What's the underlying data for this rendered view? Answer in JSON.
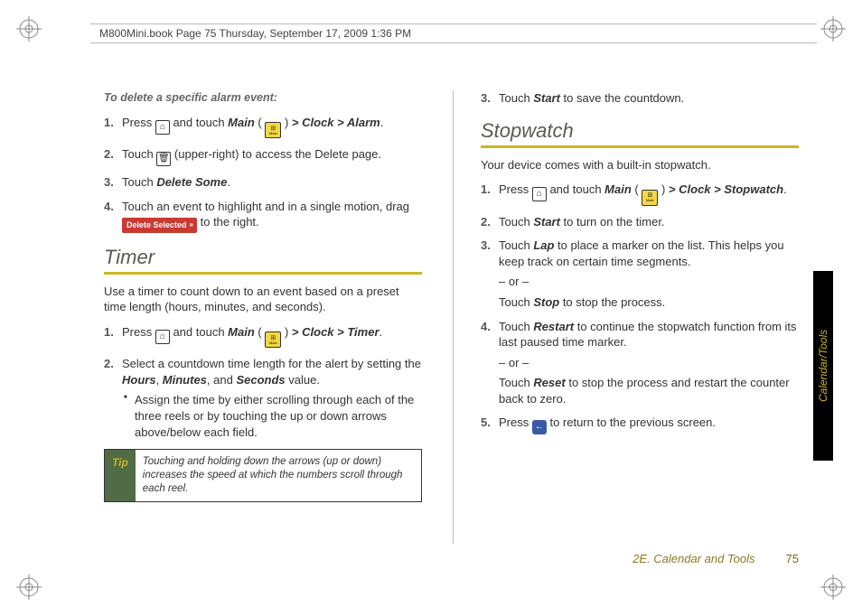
{
  "header": "M800Mini.book  Page 75  Thursday, September 17, 2009  1:36 PM",
  "left": {
    "delete_heading": "To delete a specific alarm event:",
    "steps_delete": [
      {
        "n": "1.",
        "pre": "Press ",
        "btn": "home",
        "mid": " and touch ",
        "label": "Main",
        "paren_open": " ( ",
        "main_icon": "main",
        "paren_close": " ) ",
        "path": "> Clock > Alarm",
        "post": "."
      },
      {
        "n": "2.",
        "pre": "Touch ",
        "btn": "delete-page",
        "post": " (upper-right) to access the Delete page."
      },
      {
        "n": "3.",
        "pre": "Touch ",
        "label": "Delete Some",
        "post": "."
      },
      {
        "n": "4.",
        "pre": "Touch an event to highlight and in a single motion, drag ",
        "redbtn": "Delete Selected",
        "post": " to the right."
      }
    ],
    "timer_heading": "Timer",
    "timer_intro": "Use a timer to count down to an event based on a preset time length (hours, minutes, and seconds).",
    "steps_timer": [
      {
        "n": "1.",
        "pre": "Press ",
        "btn": "home",
        "mid": " and touch ",
        "label": "Main",
        "paren_open": " ( ",
        "main_icon": "main",
        "paren_close": " ) ",
        "path": "> Clock > Timer",
        "post": "."
      },
      {
        "n": "2.",
        "pre": "Select a countdown time length for the alert by setting the ",
        "terms": [
          "Hours",
          "Minutes",
          "Seconds"
        ],
        "post": " value.",
        "bullet": "Assign the time by either scrolling through each of the three reels or by touching the up or down arrows above/below each field."
      }
    ],
    "tip_label": "Tip",
    "tip_text": "Touching and holding down the arrows (up or down) increases the speed at which the numbers scroll through each reel."
  },
  "right": {
    "continuation_step": {
      "n": "3.",
      "pre": "Touch ",
      "label": "Start",
      "post": " to save the countdown."
    },
    "stopwatch_heading": "Stopwatch",
    "stopwatch_intro": "Your device comes with a built-in stopwatch.",
    "steps_stopwatch": [
      {
        "n": "1.",
        "pre": "Press ",
        "btn": "home",
        "mid": " and touch ",
        "label": "Main",
        "paren_open": " ( ",
        "main_icon": "main",
        "paren_close": " ) ",
        "path": "> Clock > Stopwatch",
        "post": "."
      },
      {
        "n": "2.",
        "pre": "Touch ",
        "label": "Start",
        "post": " to turn on the timer."
      },
      {
        "n": "3.",
        "pre": "Touch ",
        "label": "Lap",
        "post": " to place a marker on the list. This helps you keep track on certain time segments.",
        "or": "– or –",
        "alt_pre": "Touch ",
        "alt_label": "Stop",
        "alt_post": " to stop the process."
      },
      {
        "n": "4.",
        "pre": "Touch ",
        "label": "Restart",
        "post": " to continue the stopwatch function from its last paused time marker.",
        "or": "– or –",
        "alt_pre": "Touch ",
        "alt_label": "Reset",
        "alt_post": " to stop the process and restart the counter back to zero."
      },
      {
        "n": "5.",
        "pre": "Press ",
        "btn": "back",
        "post": " to return to the previous screen."
      }
    ]
  },
  "side_tab": "Calendar/Tools",
  "footer_section": "2E. Calendar and Tools",
  "footer_page": "75"
}
